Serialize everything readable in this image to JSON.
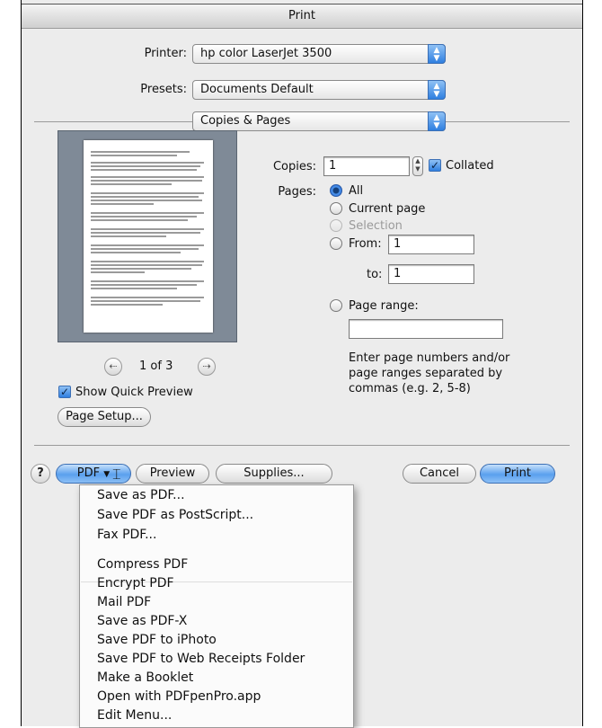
{
  "window": {
    "title": "Print"
  },
  "printer": {
    "label": "Printer:",
    "value": "hp color LaserJet 3500"
  },
  "presets": {
    "label": "Presets:",
    "value": "Documents Default"
  },
  "section": {
    "value": "Copies & Pages"
  },
  "preview": {
    "page_indicator": "1 of 3",
    "show_quick_preview": "Show Quick Preview",
    "show_quick_preview_checked": true,
    "page_setup": "Page Setup..."
  },
  "copies": {
    "label": "Copies:",
    "value": "1",
    "collated": "Collated",
    "collated_checked": true
  },
  "pages": {
    "label": "Pages:",
    "all": "All",
    "current_page": "Current page",
    "selection": "Selection",
    "from": "From:",
    "from_value": "1",
    "to": "to:",
    "to_value": "1",
    "page_range": "Page range:",
    "page_range_value": "",
    "hint_line1": "Enter page numbers and/or",
    "hint_line2": "page ranges separated by",
    "hint_line3": "commas (e.g. 2, 5-8)",
    "selected": "All"
  },
  "buttons": {
    "help": "?",
    "pdf": "PDF",
    "preview": "Preview",
    "supplies": "Supplies...",
    "cancel": "Cancel",
    "print": "Print"
  },
  "pdf_menu": {
    "items": [
      "Save as PDF...",
      "Save PDF as PostScript...",
      "Fax PDF...",
      "Compress PDF",
      "Encrypt PDF",
      "Mail PDF",
      "Save as PDF-X",
      "Save PDF to iPhoto",
      "Save PDF to Web Receipts Folder",
      "Make a Booklet",
      "Open with PDFpenPro.app",
      "Edit Menu..."
    ]
  },
  "icons": {
    "popup_arrows": "up-down-arrows-icon",
    "prev": "left-arrow-icon",
    "next": "right-arrow-icon",
    "check": "checkmark-icon"
  },
  "colors": {
    "accent": "#4d95ef",
    "dialog_bg": "#ececec",
    "preview_bg": "#7f8a97"
  }
}
